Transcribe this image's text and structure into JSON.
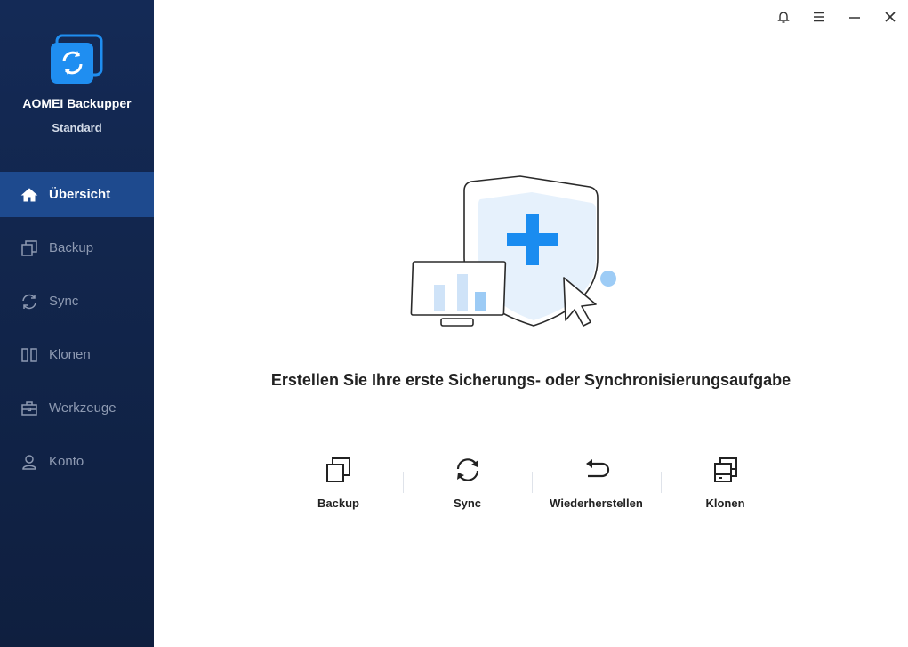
{
  "app": {
    "name": "AOMEI Backupper",
    "edition": "Standard"
  },
  "sidebar": {
    "items": [
      {
        "label": "Übersicht",
        "icon": "home-icon",
        "active": true
      },
      {
        "label": "Backup",
        "icon": "backup-icon",
        "active": false
      },
      {
        "label": "Sync",
        "icon": "sync-icon",
        "active": false
      },
      {
        "label": "Klonen",
        "icon": "clone-icon",
        "active": false
      },
      {
        "label": "Werkzeuge",
        "icon": "toolbox-icon",
        "active": false
      },
      {
        "label": "Konto",
        "icon": "user-icon",
        "active": false
      }
    ]
  },
  "titlebar": {
    "icons": [
      "bell-icon",
      "menu-icon",
      "minimize-icon",
      "close-icon"
    ]
  },
  "main": {
    "headline": "Erstellen Sie Ihre erste Sicherungs- oder Synchronisierungsaufgabe",
    "actions": [
      {
        "label": "Backup",
        "icon": "backup-icon"
      },
      {
        "label": "Sync",
        "icon": "sync-icon"
      },
      {
        "label": "Wiederherstellen",
        "icon": "restore-icon"
      },
      {
        "label": "Klonen",
        "icon": "clone-disk-icon"
      }
    ]
  },
  "colors": {
    "sidebar_bg": "#132852",
    "active_item": "#1e4a8e",
    "accent_blue": "#1a8cf0",
    "light_blue": "#dcebfb"
  }
}
